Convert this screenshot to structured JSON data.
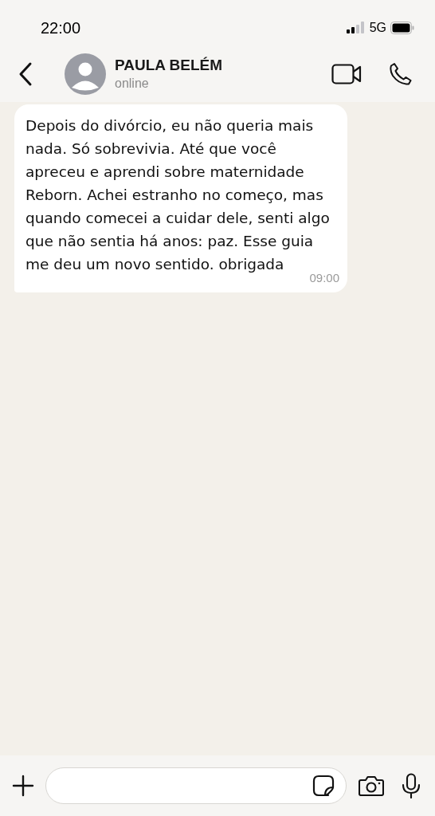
{
  "status_bar": {
    "time": "22:00",
    "network": "5G"
  },
  "header": {
    "contact_name": "PAULA BELÉM",
    "presence": "online"
  },
  "messages": [
    {
      "text": "Depois do divórcio, eu não queria mais nada. Só sobrevivia. Até que você apreceu e aprendi sobre maternidade Reborn. Achei estranho no começo, mas quando comecei a cuidar dele, senti algo que não sentia há anos: paz. Esse guia me deu um novo sentido. obrigada",
      "time": "09:00",
      "outgoing": false
    }
  ]
}
